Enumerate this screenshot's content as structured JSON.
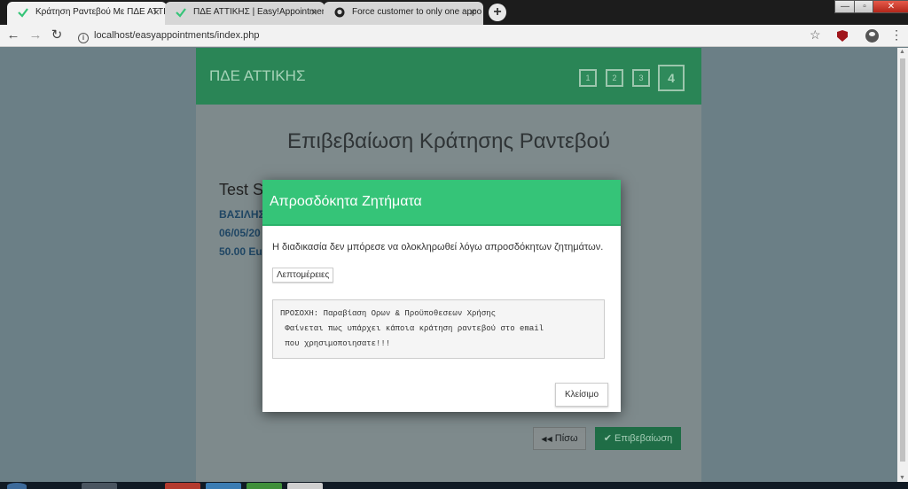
{
  "browser": {
    "tabs": [
      {
        "title": "Κράτηση Ραντεβού Με ΠΔΕ ΑΤΤΙ",
        "active": true,
        "icon": "check-logo-icon"
      },
      {
        "title": "ΠΔΕ ΑΤΤΙΚΗΣ | Easy!Appointmen",
        "active": false,
        "icon": "check-logo-icon"
      },
      {
        "title": "Force customer to only one appo",
        "active": false,
        "icon": "github-icon"
      }
    ],
    "tab_close": "×",
    "new_tab": "+",
    "window_controls": {
      "minimize": "—",
      "maximize": "▫",
      "close": "✕"
    },
    "nav": {
      "back": "←",
      "forward": "→",
      "reload": "↻"
    },
    "url": "localhost/easyappointments/index.php",
    "info_glyph": "i",
    "bookmark_glyph": "☆",
    "menu_glyph": "⋮"
  },
  "booking": {
    "header_title": "ΠΔΕ ΑΤΤΙΚΗΣ",
    "steps": [
      "1",
      "2",
      "3",
      "4"
    ],
    "active_step": 4,
    "page_title": "Επιβεβαίωση Κράτησης Ραντεβού",
    "service_name": "Test S",
    "details": [
      "ΒΑΣΙΛΗΣ",
      "06/05/20",
      "50.00 Eu"
    ],
    "back_label": "Πίσω",
    "back_glyph": "◀◀",
    "confirm_label": "Επιβεβαίωση",
    "confirm_glyph": "✔"
  },
  "modal": {
    "title": "Απροσδόκητα Ζητήματα",
    "message": "Η διαδικασία δεν μπόρεσε να ολοκληρωθεί λόγω απροσδόκητων ζητημάτων.",
    "details_button": "Λεπτομέρειες",
    "details_lines": [
      "ΠΡΟΣΟΧΗ: Παραβίαση Ορων & Προϋποθεσεων Χρήσης",
      " Φαίνεται πως υπάρχει κάποια κράτηση ραντεβού στο email",
      " που χρησιμοποιησατε!!!"
    ],
    "close_button": "Κλείσιμο"
  },
  "colors": {
    "modal_header": "#35c478",
    "booking_header": "#2a8556",
    "detail_text": "#1f4664",
    "overlay_bg": "#6b7f86"
  }
}
